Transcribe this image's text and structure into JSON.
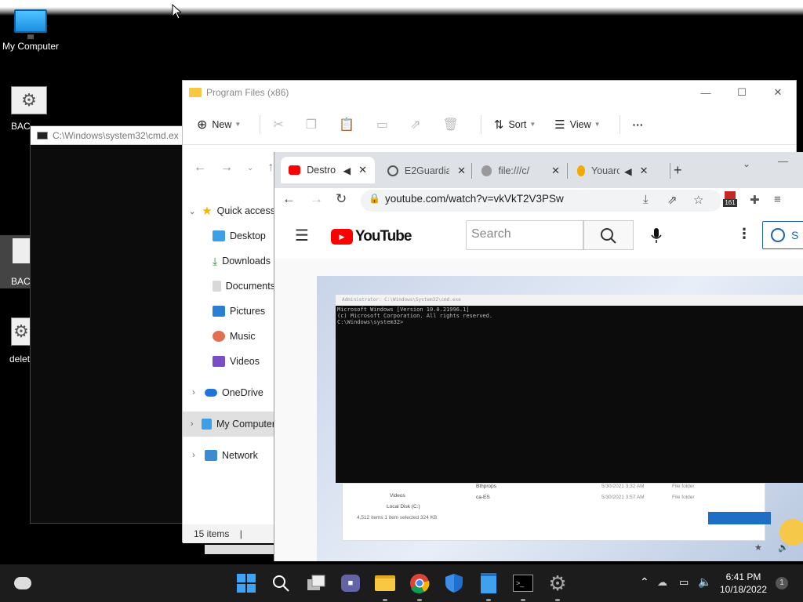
{
  "desktop": {
    "icons": [
      {
        "label": "My Computer"
      },
      {
        "label": "BAC"
      },
      {
        "label": "BAC"
      },
      {
        "label": "delet"
      }
    ]
  },
  "cmd": {
    "title": "C:\\Windows\\system32\\cmd.ex"
  },
  "explorer": {
    "title": "Program Files (x86)",
    "toolbar": {
      "new": "New",
      "sort": "Sort",
      "view": "View",
      "more": "···"
    },
    "nav_items": [
      {
        "label": "Quick access",
        "icon": "star-icon"
      },
      {
        "label": "Desktop",
        "icon": "desktop-icon"
      },
      {
        "label": "Downloads",
        "icon": "download-icon"
      },
      {
        "label": "Documents",
        "icon": "documents-icon"
      },
      {
        "label": "Pictures",
        "icon": "pictures-icon"
      },
      {
        "label": "Music",
        "icon": "music-icon"
      },
      {
        "label": "Videos",
        "icon": "videos-icon"
      },
      {
        "label": "OneDrive",
        "icon": "cloud-icon"
      },
      {
        "label": "My Computer",
        "icon": "monitor-icon"
      },
      {
        "label": "Network",
        "icon": "network-icon"
      }
    ],
    "status": "15 items"
  },
  "chrome": {
    "tabs": [
      {
        "label": "Destro",
        "favicon": "youtube-icon"
      },
      {
        "label": "E2Guardia",
        "favicon": "globe-icon"
      },
      {
        "label": "file:///c/",
        "favicon": "globe-icon"
      },
      {
        "label": "Youarc",
        "favicon": "bitcoin-icon"
      }
    ],
    "url": "youtube.com/watch?v=vkVkT2V3PSw",
    "ext_badge": "161",
    "youtube": {
      "logo_text": "YouTube",
      "search_placeholder": "Search",
      "signin_label": "S"
    },
    "video": {
      "cmd_title": "Administrator: C:\\Windows\\System32\\cmd.exe",
      "cmd_lines": [
        "Microsoft Windows [Version 10.0.21996.1]",
        "(c) Microsoft Corporation. All rights reserved.",
        "",
        "C:\\Windows\\system32>"
      ],
      "explorer_rows": [
        {
          "name": "Videos",
          "date": "",
          "type": ""
        },
        {
          "name": "Local Disk (C:)",
          "date": "",
          "type": ""
        },
        {
          "name": "Bthprops",
          "date": "5/30/2021 3:32 AM",
          "type": "File folder"
        },
        {
          "name": "ca-ES",
          "date": "5/30/2021 3:57 AM",
          "type": "File folder"
        }
      ],
      "explorer_status": "4,512 items    1 item selected  324 KB"
    }
  },
  "taskbar": {
    "time": "6:41 PM",
    "date": "10/18/2022",
    "notif_count": "1"
  }
}
